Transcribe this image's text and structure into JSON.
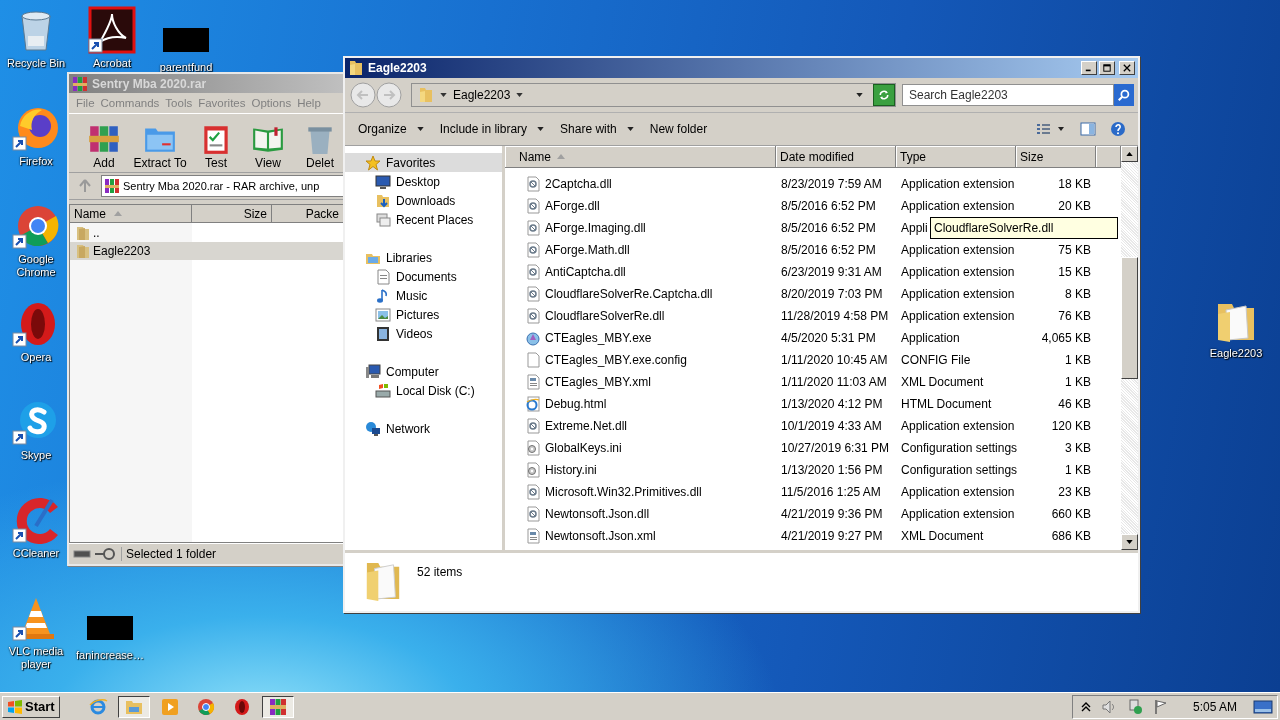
{
  "desktop_icons": [
    {
      "label": "Recycle Bin",
      "kind": "recycle"
    },
    {
      "label": "Acrobat",
      "kind": "acrobat"
    },
    {
      "label": "parentfund",
      "kind": "redacted"
    },
    {
      "label": "Firefox",
      "kind": "firefox"
    },
    {
      "label": "Google Chrome",
      "kind": "chrome"
    },
    {
      "label": "Opera",
      "kind": "opera"
    },
    {
      "label": "Skype",
      "kind": "skype"
    },
    {
      "label": "CCleaner",
      "kind": "ccleaner"
    },
    {
      "label": "VLC media player",
      "kind": "vlc"
    },
    {
      "label": "fanincrease…",
      "kind": "redacted"
    },
    {
      "label": "Eagle2203",
      "kind": "folder"
    }
  ],
  "archive_window": {
    "title": "Sentry Mba 2020.rar",
    "active": false,
    "menu": [
      "File",
      "Commands",
      "Tools",
      "Favorites",
      "Options",
      "Help"
    ],
    "toolbar": [
      {
        "label": "Add",
        "kind": "add"
      },
      {
        "label": "Extract To",
        "kind": "extract"
      },
      {
        "label": "Test",
        "kind": "test"
      },
      {
        "label": "View",
        "kind": "view"
      },
      {
        "label": "Delet",
        "kind": "delete"
      }
    ],
    "address": "Sentry Mba 2020.rar - RAR archive, unp",
    "columns": [
      {
        "label": "Name",
        "sorted": true
      },
      {
        "label": "Size",
        "sorted": false
      },
      {
        "label": "Packe",
        "sorted": false
      }
    ],
    "rows": [
      {
        "name": "..",
        "selected": false
      },
      {
        "name": "Eagle2203",
        "selected": true
      }
    ],
    "status": "Selected 1 folder"
  },
  "explorer_window": {
    "title": "Eagle2203",
    "active": true,
    "breadcrumb": "Eagle2203",
    "search": {
      "placeholder": "Search Eagle2203"
    },
    "commands": [
      {
        "label": "Organize",
        "dropdown": true
      },
      {
        "label": "Include in library",
        "dropdown": true
      },
      {
        "label": "Share with",
        "dropdown": true
      },
      {
        "label": "New folder",
        "dropdown": false
      }
    ],
    "navigation": [
      {
        "label": "Favorites",
        "kind": "star",
        "selected": true,
        "children": [
          {
            "label": "Desktop",
            "kind": "desktop",
            "selected": false
          },
          {
            "label": "Downloads",
            "kind": "downloads",
            "selected": false
          },
          {
            "label": "Recent Places",
            "kind": "recent",
            "selected": false
          }
        ]
      },
      {
        "label": "Libraries",
        "kind": "libraries",
        "selected": false,
        "children": [
          {
            "label": "Documents",
            "kind": "documents",
            "selected": false
          },
          {
            "label": "Music",
            "kind": "music",
            "selected": false
          },
          {
            "label": "Pictures",
            "kind": "pictures",
            "selected": false
          },
          {
            "label": "Videos",
            "kind": "videos",
            "selected": false
          }
        ]
      },
      {
        "label": "Computer",
        "kind": "computer",
        "selected": false,
        "children": [
          {
            "label": "Local Disk (C:)",
            "kind": "disk",
            "selected": false
          }
        ]
      },
      {
        "label": "Network",
        "kind": "network",
        "selected": false
      }
    ],
    "columns": [
      {
        "label": "Name",
        "sorted": true
      },
      {
        "label": "Date modified",
        "sorted": false
      },
      {
        "label": "Type",
        "sorted": false
      },
      {
        "label": "Size",
        "sorted": false
      }
    ],
    "files": [
      {
        "name": "2Captcha.dll",
        "kind": "dll",
        "date": "8/23/2019 7:59 AM",
        "type": "Application extension",
        "size": "18 KB"
      },
      {
        "name": "AForge.dll",
        "kind": "dll",
        "date": "8/5/2016 6:52 PM",
        "type": "Application extension",
        "size": "20 KB"
      },
      {
        "name": "AForge.Imaging.dll",
        "kind": "dll",
        "date": "8/5/2016 6:52 PM",
        "type": "Appli"
      },
      {
        "name": "AForge.Math.dll",
        "kind": "dll",
        "date": "8/5/2016 6:52 PM",
        "type": "Application extension",
        "size": "75 KB"
      },
      {
        "name": "AntiCaptcha.dll",
        "kind": "dll",
        "date": "6/23/2019 9:31 AM",
        "type": "Application extension",
        "size": "15 KB"
      },
      {
        "name": "CloudflareSolverRe.Captcha.dll",
        "kind": "dll",
        "date": "8/20/2019 7:03 PM",
        "type": "Application extension",
        "size": "8 KB"
      },
      {
        "name": "CloudflareSolverRe.dll",
        "kind": "dll",
        "date": "11/28/2019 4:58 PM",
        "type": "Application extension",
        "size": "76 KB"
      },
      {
        "name": "CTEagles_MBY.exe",
        "kind": "exe",
        "date": "4/5/2020 5:31 PM",
        "type": "Application",
        "size": "4,065 KB"
      },
      {
        "name": "CTEagles_MBY.exe.config",
        "kind": "file",
        "date": "1/11/2020 10:45 AM",
        "type": "CONFIG File",
        "size": "1 KB"
      },
      {
        "name": "CTEagles_MBY.xml",
        "kind": "xml",
        "date": "1/11/2020 11:03 AM",
        "type": "XML Document",
        "size": "1 KB"
      },
      {
        "name": "Debug.html",
        "kind": "html",
        "date": "1/13/2020 4:12 PM",
        "type": "HTML Document",
        "size": "46 KB"
      },
      {
        "name": "Extreme.Net.dll",
        "kind": "dll",
        "date": "10/1/2019 4:33 AM",
        "type": "Application extension",
        "size": "120 KB"
      },
      {
        "name": "GlobalKeys.ini",
        "kind": "ini",
        "date": "10/27/2019 6:31 PM",
        "type": "Configuration settings",
        "size": "3 KB"
      },
      {
        "name": "History.ini",
        "kind": "ini",
        "date": "1/13/2020 1:56 PM",
        "type": "Configuration settings",
        "size": "1 KB"
      },
      {
        "name": "Microsoft.Win32.Primitives.dll",
        "kind": "dll",
        "date": "11/5/2016 1:25 AM",
        "type": "Application extension",
        "size": "23 KB"
      },
      {
        "name": "Newtonsoft.Json.dll",
        "kind": "dll",
        "date": "4/21/2019 9:36 PM",
        "type": "Application extension",
        "size": "660 KB"
      },
      {
        "name": "Newtonsoft.Json.xml",
        "kind": "xml",
        "date": "4/21/2019 9:27 PM",
        "type": "XML Document",
        "size": "686 KB"
      }
    ],
    "tooltip": "CloudflareSolverRe.dll",
    "item_count": "52 items"
  },
  "taskbar": {
    "start": "Start",
    "items": [
      {
        "kind": "ie",
        "selected": false
      },
      {
        "kind": "explorer",
        "selected": true
      },
      {
        "kind": "media",
        "selected": false
      },
      {
        "kind": "chrome",
        "selected": false
      },
      {
        "kind": "opera",
        "selected": false
      },
      {
        "kind": "archiver",
        "selected": true
      }
    ],
    "clock": "5:05 AM"
  }
}
